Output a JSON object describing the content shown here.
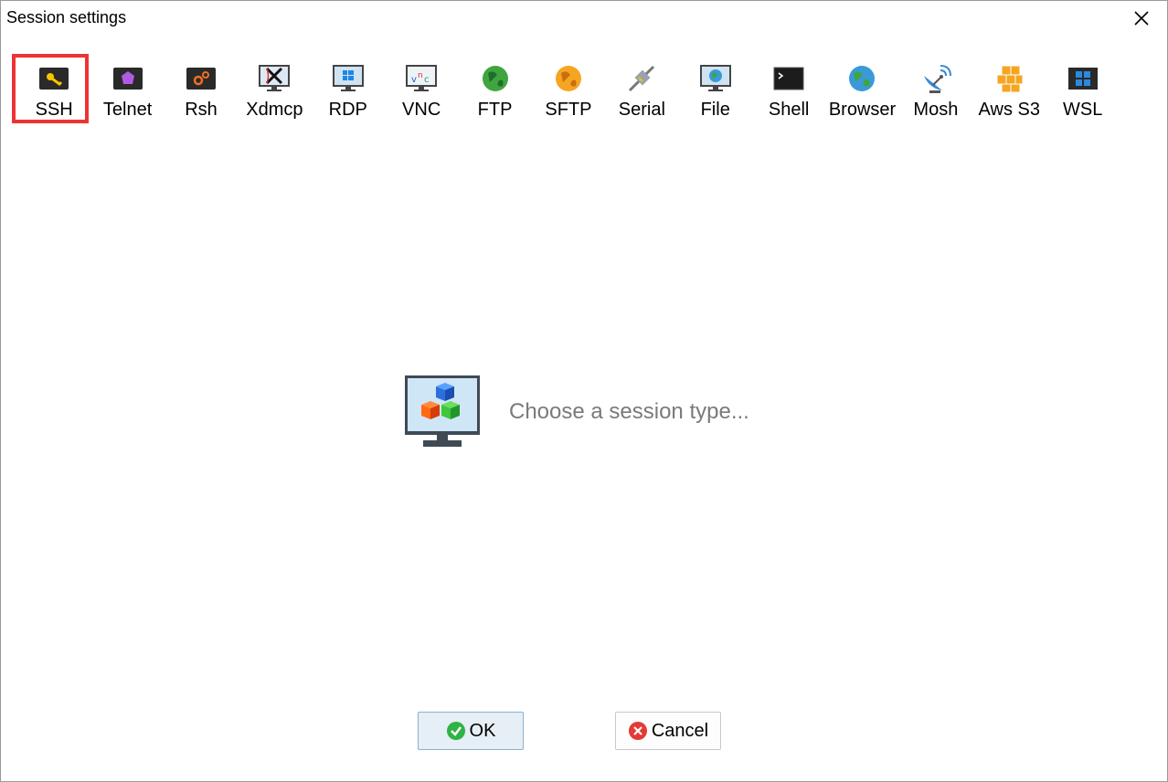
{
  "window": {
    "title": "Session settings"
  },
  "session_types": [
    {
      "label": "SSH",
      "icon": "ssh-key-icon",
      "selected": true
    },
    {
      "label": "Telnet",
      "icon": "telnet-icon"
    },
    {
      "label": "Rsh",
      "icon": "rsh-icon"
    },
    {
      "label": "Xdmcp",
      "icon": "xdmcp-icon"
    },
    {
      "label": "RDP",
      "icon": "rdp-icon"
    },
    {
      "label": "VNC",
      "icon": "vnc-icon"
    },
    {
      "label": "FTP",
      "icon": "ftp-globe-icon"
    },
    {
      "label": "SFTP",
      "icon": "sftp-globe-icon"
    },
    {
      "label": "Serial",
      "icon": "serial-plug-icon"
    },
    {
      "label": "File",
      "icon": "file-monitor-icon"
    },
    {
      "label": "Shell",
      "icon": "shell-terminal-icon"
    },
    {
      "label": "Browser",
      "icon": "browser-globe-icon"
    },
    {
      "label": "Mosh",
      "icon": "mosh-satellite-icon"
    },
    {
      "label": "Aws S3",
      "icon": "aws-s3-cubes-icon"
    },
    {
      "label": "WSL",
      "icon": "wsl-windows-icon"
    }
  ],
  "main": {
    "hint": "Choose a session type..."
  },
  "buttons": {
    "ok": "OK",
    "cancel": "Cancel"
  },
  "colors": {
    "selection_border": "#ee3333",
    "ok_icon": "#2fb344",
    "cancel_icon": "#e53935"
  }
}
